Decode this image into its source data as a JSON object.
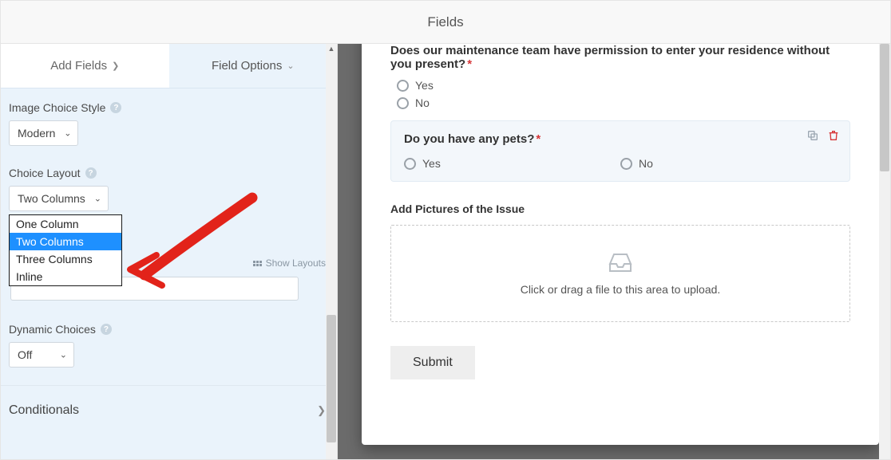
{
  "header": {
    "title": "Fields"
  },
  "tabs": {
    "add": "Add Fields",
    "options": "Field Options"
  },
  "panel": {
    "image_style_label": "Image Choice Style",
    "image_style_value": "Modern",
    "choice_layout_label": "Choice Layout",
    "choice_layout_value": "Two Columns",
    "layout_options": {
      "one": "One Column",
      "two": "Two Columns",
      "three": "Three Columns",
      "inline": "Inline"
    },
    "show_layouts": "Show Layouts",
    "dynamic_label": "Dynamic Choices",
    "dynamic_value": "Off",
    "conditionals": "Conditionals"
  },
  "form": {
    "q1": "Does our maintenance team have permission to enter your residence without you present?",
    "yes": "Yes",
    "no": "No",
    "q2": "Do you have any pets?",
    "upload_label": "Add Pictures of the Issue",
    "upload_hint": "Click or drag a file to this area to upload.",
    "submit": "Submit"
  }
}
